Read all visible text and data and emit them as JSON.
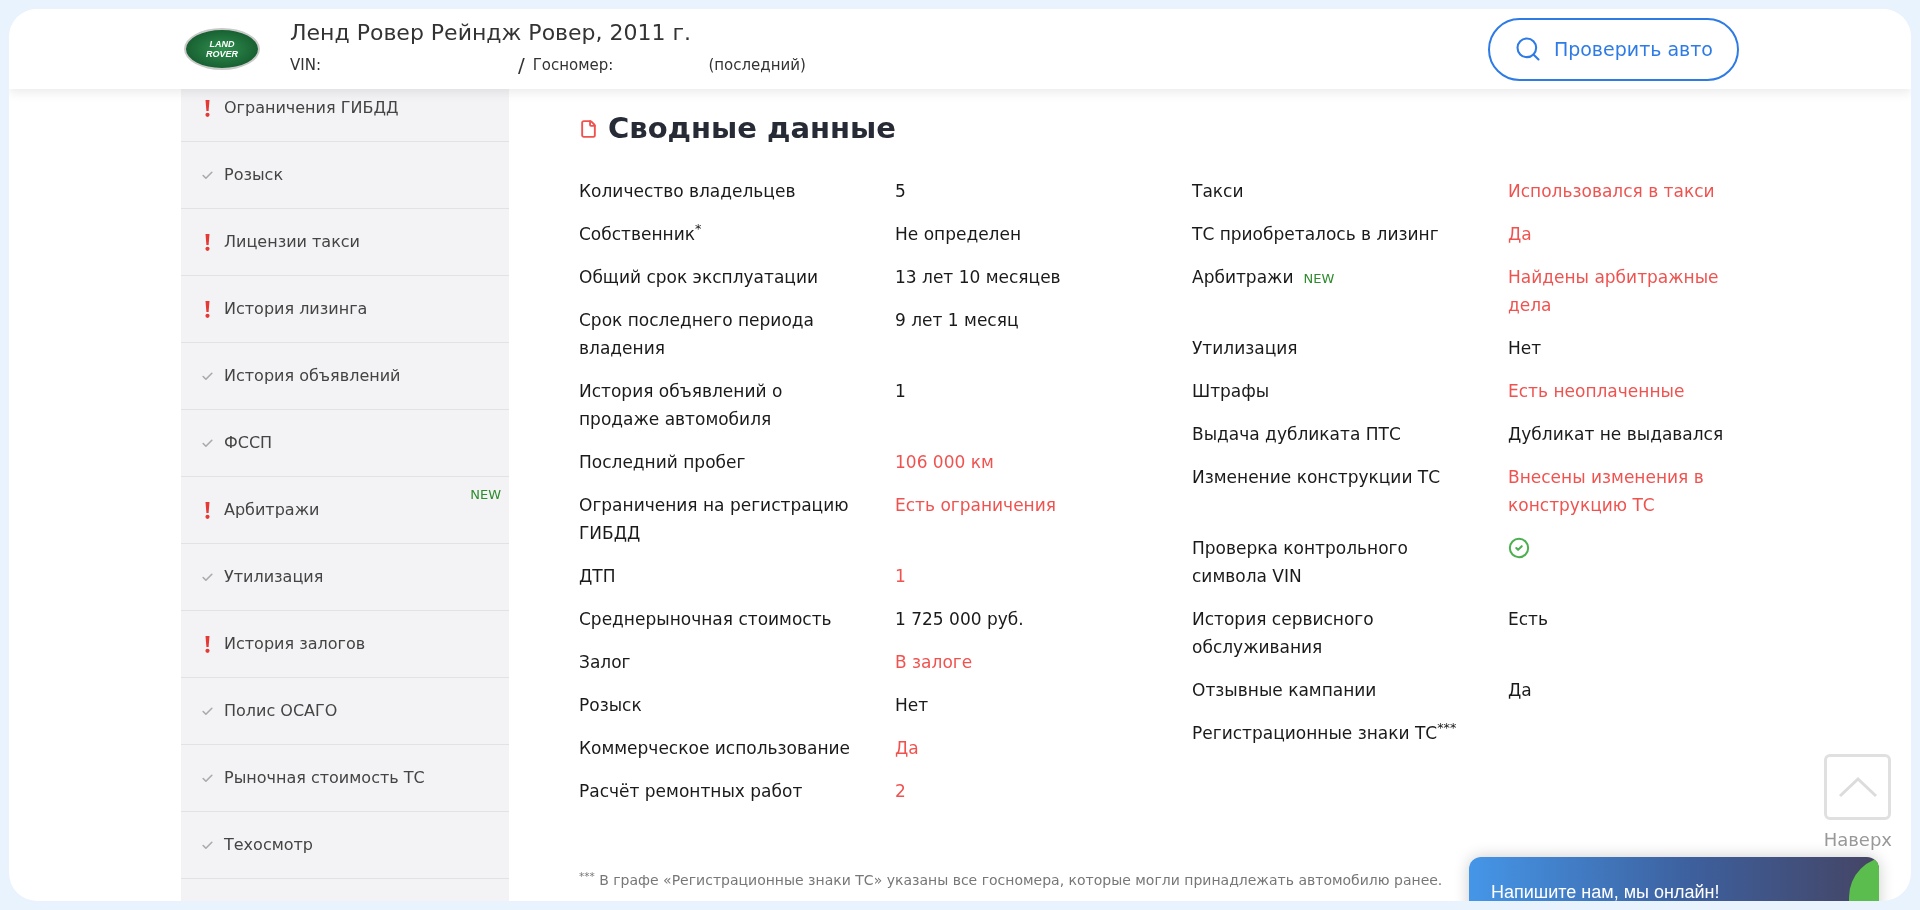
{
  "header": {
    "logo": {
      "line_1": "LAND",
      "line_2": "ROVER"
    },
    "title": "Ленд Ровер Рейндж Ровер, 2011 г.",
    "vin_label": "VIN:",
    "separator": "/",
    "plate_label": "Госномер:",
    "plate_note": "(последний)",
    "check_button": "Проверить авто"
  },
  "sidebar": {
    "items": [
      {
        "label": "Ограничения ГИБДД",
        "warning": true
      },
      {
        "label": "Розыск",
        "warning": false
      },
      {
        "label": "Лицензии такси",
        "warning": true
      },
      {
        "label": "История лизинга",
        "warning": true
      },
      {
        "label": "История объявлений",
        "warning": false
      },
      {
        "label": "ФССП",
        "warning": false
      },
      {
        "label": "Арбитражи",
        "warning": true,
        "badge": "NEW"
      },
      {
        "label": "Утилизация",
        "warning": false
      },
      {
        "label": "История залогов",
        "warning": true
      },
      {
        "label": "Полис ОСАГО",
        "warning": false
      },
      {
        "label": "Рыночная стоимость ТС",
        "warning": false
      },
      {
        "label": "Техосмотр",
        "warning": false
      }
    ]
  },
  "summary": {
    "title": "Сводные данные",
    "left_rows": [
      {
        "label": "Количество владельцев",
        "kind": "text",
        "value": "5",
        "alert": false
      },
      {
        "label": "Собственник$^{*}$",
        "kind": "text",
        "value": "Не определен",
        "alert": false
      },
      {
        "label": "Общий срок эксплуатации",
        "kind": "text",
        "value": "13 лет 10 месяцев",
        "alert": false
      },
      {
        "label": "Срок последнего периода владения",
        "kind": "text",
        "value": "9 лет 1 месяц",
        "alert": false
      },
      {
        "label": "История объявлений о продаже автомобиля",
        "kind": "text",
        "value": "1",
        "alert": false
      },
      {
        "label": "Последний пробег",
        "kind": "text",
        "value": "106 000 км",
        "alert": true
      },
      {
        "label": "Ограничения на регистрацию ГИБДД",
        "kind": "text",
        "value": "Есть ограничения",
        "alert": true
      },
      {
        "label": "ДТП",
        "kind": "text",
        "value": "1",
        "alert": true
      },
      {
        "label": "Среднерыночная стоимость",
        "kind": "text",
        "value": "1 725 000 руб.",
        "alert": false
      },
      {
        "label": "Залог",
        "kind": "text",
        "value": "В залоге",
        "alert": true
      },
      {
        "label": "Розыск",
        "kind": "text",
        "value": "Нет",
        "alert": false
      },
      {
        "label": "Коммерческое использование",
        "kind": "text",
        "value": "Да",
        "alert": true
      },
      {
        "label": "Расчёт ремонтных работ",
        "kind": "text",
        "value": "2",
        "alert": true
      }
    ],
    "right_rows": [
      {
        "label": "Такси",
        "kind": "text",
        "value": "Использовался в такси",
        "alert": true
      },
      {
        "label": "ТС приобреталось в лизинг",
        "kind": "text",
        "value": "Да",
        "alert": true
      },
      {
        "label": "Арбитражи",
        "badge": "NEW",
        "kind": "text",
        "value": "Найдены арбитражные дела",
        "alert": true
      },
      {
        "label": "Утилизация",
        "kind": "text",
        "value": "Нет",
        "alert": false
      },
      {
        "label": "Штрафы",
        "kind": "text",
        "value": "Есть неоплаченные",
        "alert": true
      },
      {
        "label": "Выдача дубликата ПТС",
        "kind": "text",
        "value": "Дубликат не выдавался",
        "alert": false
      },
      {
        "label": "Изменение конструкции ТС",
        "kind": "text",
        "value": "Внесены изменения в конструкцию ТС",
        "alert": true
      },
      {
        "label": "Проверка контрольного символа VIN",
        "kind": "check"
      },
      {
        "label": "История сервисного обслуживания",
        "kind": "text",
        "value": "Есть",
        "alert": false
      },
      {
        "label": "Отзывные кампании",
        "kind": "text",
        "value": "Да",
        "alert": false
      },
      {
        "label": "Регистрационные знаки ТС$^{***}$",
        "kind": "empty"
      }
    ],
    "footnote": "$^{***}$ В графе «Регистрационные знаки ТС» указаны все госномера, которые могли принадлежать автомобилю ранее."
  },
  "scroll_top": {
    "label": "Наверх"
  },
  "chat": {
    "text": "Напишите нам, мы онлайн!"
  }
}
